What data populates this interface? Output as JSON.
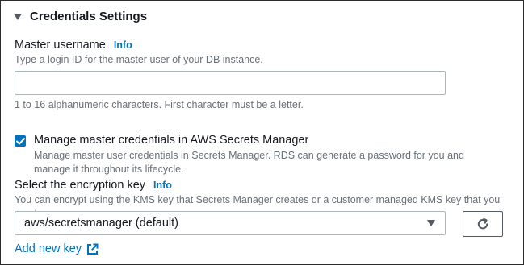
{
  "section": {
    "title": "Credentials Settings"
  },
  "master_username": {
    "label": "Master username",
    "info": "Info",
    "description": "Type a login ID for the master user of your DB instance.",
    "value": "",
    "constraint": "1 to 16 alphanumeric characters. First character must be a letter."
  },
  "secrets_manager": {
    "checked": true,
    "label": "Manage master credentials in AWS Secrets Manager",
    "description_line1": "Manage master user credentials in Secrets Manager. RDS can generate a password for you and",
    "description_line2": "manage it throughout its lifecycle."
  },
  "encryption_key": {
    "label": "Select the encryption key",
    "info": "Info",
    "description": "You can encrypt using the KMS key that Secrets Manager creates or a customer managed KMS key that you create.",
    "selected": "aws/secretsmanager (default)",
    "add_link": "Add new key"
  },
  "icons": {
    "section_toggle": "caret-down-icon",
    "checkbox": "checkmark-icon",
    "dropdown": "caret-down-icon",
    "refresh": "refresh-icon",
    "external": "external-link-icon"
  },
  "colors": {
    "link": "#0073bb",
    "checkbox": "#0073bb",
    "text": "#16191f",
    "secondary_text": "#687078",
    "border": "#aab7b8"
  }
}
